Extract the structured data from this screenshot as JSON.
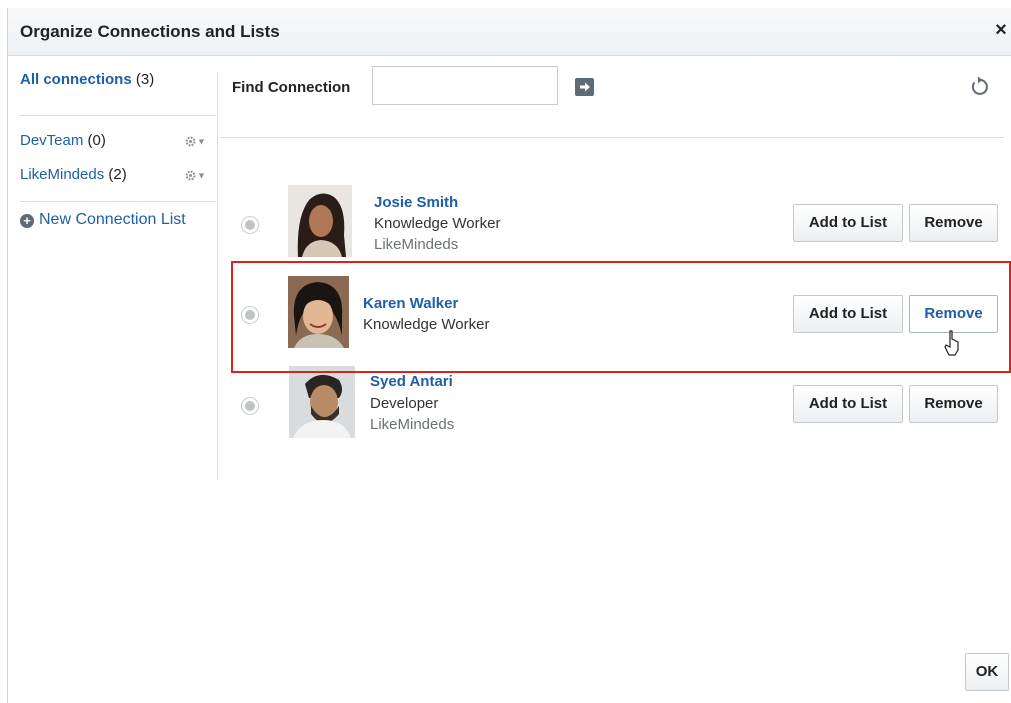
{
  "dialog": {
    "title": "Organize Connections and Lists",
    "close_glyph": "×"
  },
  "sidebar": {
    "all": {
      "label": "All connections",
      "count": "(3)"
    },
    "lists": [
      {
        "label": "DevTeam",
        "count": "(0)"
      },
      {
        "label": "LikeMindeds",
        "count": "(2)"
      }
    ],
    "new_list_label": "New Connection List",
    "new_list_icon": "plus-circle-icon",
    "gear_icon": "gear-dropdown-icon"
  },
  "search": {
    "label": "Find Connection",
    "value": "",
    "placeholder": "",
    "go_icon": "arrow-right-icon",
    "refresh_icon": "refresh-icon"
  },
  "connections": [
    {
      "name": "Josie Smith",
      "title": "Knowledge Worker",
      "list": "LikeMindeds"
    },
    {
      "name": "Karen Walker",
      "title": "Knowledge Worker",
      "list": ""
    },
    {
      "name": "Syed Antari",
      "title": "Developer",
      "list": "LikeMindeds"
    }
  ],
  "buttons": {
    "add_to_list": "Add to List",
    "remove": "Remove",
    "ok": "OK"
  },
  "colors": {
    "link": "#1f5fa8",
    "highlight": "#d9241e"
  }
}
